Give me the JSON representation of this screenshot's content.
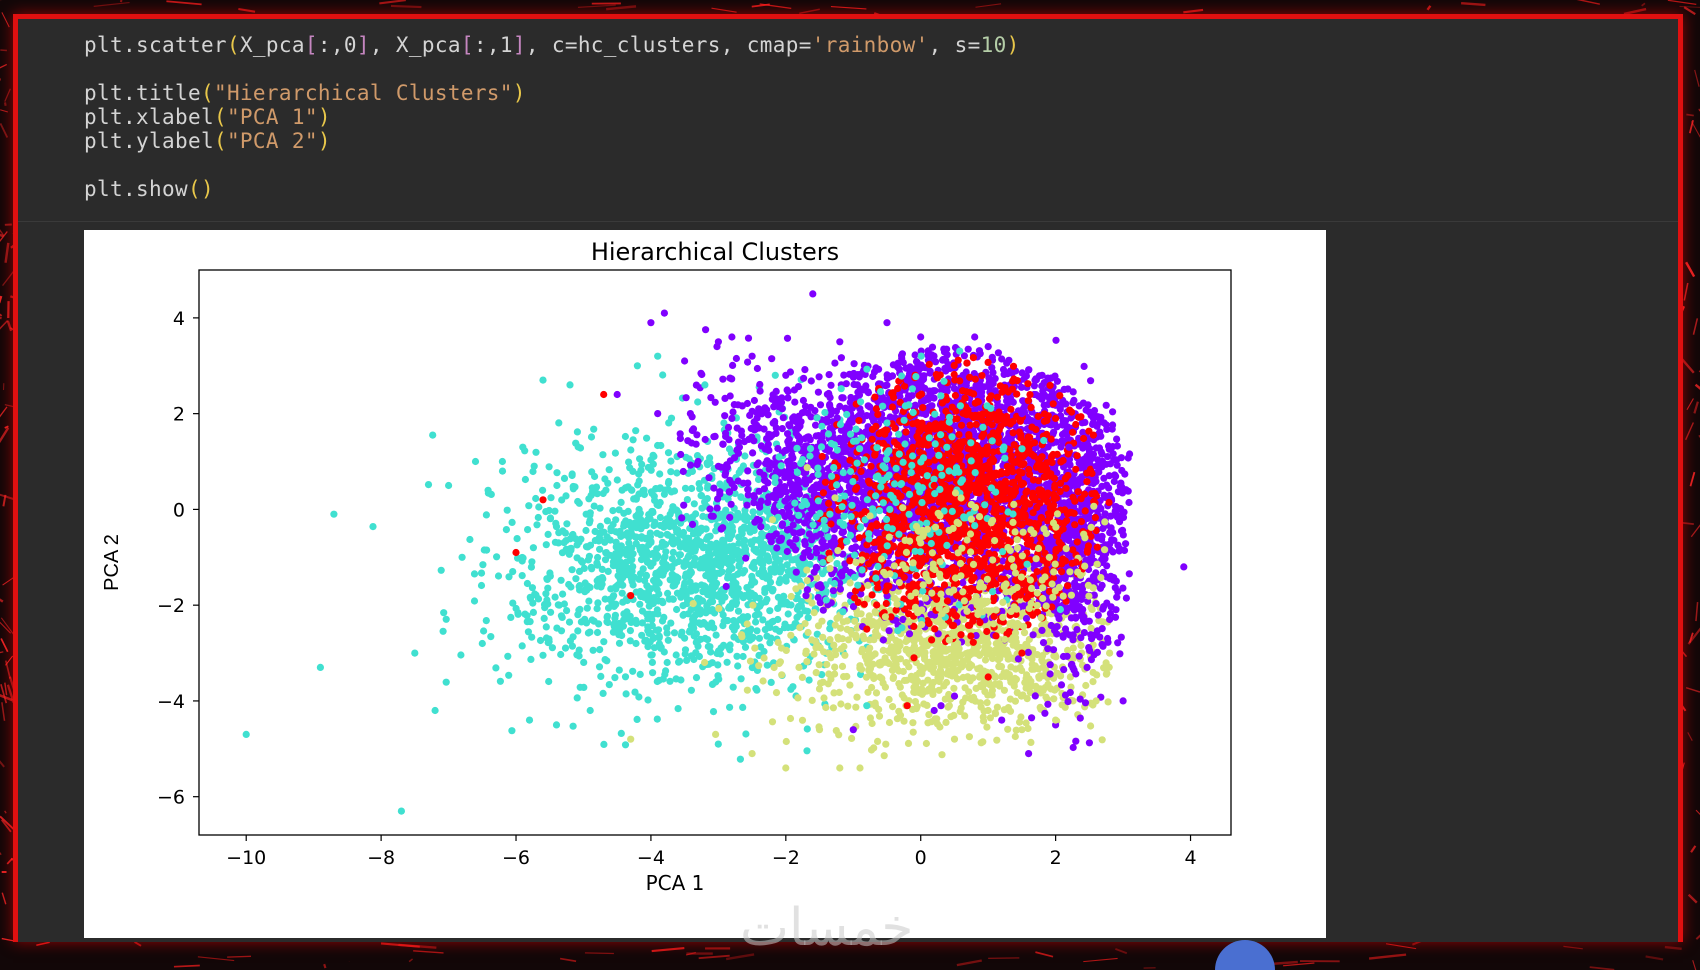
{
  "code": {
    "lines": [
      [
        {
          "t": "plt.scatter",
          "c": "tk-id"
        },
        {
          "t": "(",
          "c": "tk-br"
        },
        {
          "t": "X_pca",
          "c": "tk-id"
        },
        {
          "t": "[",
          "c": "tk-br2"
        },
        {
          "t": ":,0",
          "c": "tk-op"
        },
        {
          "t": "]",
          "c": "tk-br2"
        },
        {
          "t": ", ",
          "c": "tk-op"
        },
        {
          "t": "X_pca",
          "c": "tk-id"
        },
        {
          "t": "[",
          "c": "tk-br2"
        },
        {
          "t": ":,1",
          "c": "tk-op"
        },
        {
          "t": "]",
          "c": "tk-br2"
        },
        {
          "t": ", c=hc_clusters, cmap=",
          "c": "tk-op"
        },
        {
          "t": "'rainbow'",
          "c": "tk-str"
        },
        {
          "t": ", s=",
          "c": "tk-op"
        },
        {
          "t": "10",
          "c": "tk-num"
        },
        {
          "t": ")",
          "c": "tk-br"
        }
      ],
      [],
      [
        {
          "t": "plt.title",
          "c": "tk-id"
        },
        {
          "t": "(",
          "c": "tk-br"
        },
        {
          "t": "\"Hierarchical Clusters\"",
          "c": "tk-str"
        },
        {
          "t": ")",
          "c": "tk-br"
        }
      ],
      [
        {
          "t": "plt.xlabel",
          "c": "tk-id"
        },
        {
          "t": "(",
          "c": "tk-br"
        },
        {
          "t": "\"PCA 1\"",
          "c": "tk-str"
        },
        {
          "t": ")",
          "c": "tk-br"
        }
      ],
      [
        {
          "t": "plt.ylabel",
          "c": "tk-id"
        },
        {
          "t": "(",
          "c": "tk-br"
        },
        {
          "t": "\"PCA 2\"",
          "c": "tk-str"
        },
        {
          "t": ")",
          "c": "tk-br"
        }
      ],
      [],
      [
        {
          "t": "plt.show",
          "c": "tk-id"
        },
        {
          "t": "()",
          "c": "tk-br"
        }
      ]
    ]
  },
  "chart_data": {
    "type": "scatter",
    "title": "Hierarchical Clusters",
    "xlabel": "PCA 1",
    "ylabel": "PCA 2",
    "xlim": [
      -10.7,
      4.6
    ],
    "ylim": [
      -6.8,
      5.0
    ],
    "xticks": [
      -10,
      -8,
      -6,
      -4,
      -2,
      0,
      2,
      4
    ],
    "yticks": [
      -6,
      -4,
      -2,
      0,
      2,
      4
    ],
    "grid": false,
    "legend": "none",
    "cmap": "rainbow",
    "series": [
      {
        "color": "#8000ff",
        "x": [
          -1.6,
          -3.8,
          -4.0,
          -3.0,
          -2.8,
          -3.5,
          -2.5,
          -4.5,
          -3.9,
          -3.3,
          -2.0,
          0.8,
          3.9,
          2.0,
          1.6,
          0.2,
          3.0,
          2.8,
          2.9,
          1.5,
          -1.2,
          -0.5,
          0.0,
          1.0,
          -2.2,
          -2.8,
          -3.0,
          2.2,
          2.6,
          1.8,
          -0.2,
          0.5,
          1.2,
          -1.0,
          0.3
        ],
        "y": [
          4.5,
          4.1,
          3.9,
          3.5,
          3.6,
          3.1,
          3.2,
          2.4,
          2.0,
          1.0,
          2.8,
          3.6,
          -1.2,
          -4.5,
          -5.1,
          -4.2,
          -4.0,
          -2.3,
          -1.5,
          2.0,
          3.5,
          3.9,
          3.6,
          3.4,
          2.3,
          1.9,
          0.9,
          1.3,
          0.9,
          2.8,
          2.7,
          -3.9,
          -4.4,
          -4.6,
          -4.1
        ]
      },
      {
        "color": "#ff0000",
        "x": [
          -4.7,
          -5.6,
          -6.0,
          -4.3,
          -0.2,
          1.6,
          2.3,
          -0.5,
          0.5,
          1.0,
          1.5,
          -0.8,
          -0.1,
          0.2,
          2.0,
          1.8,
          1.2
        ],
        "y": [
          2.4,
          0.2,
          -0.9,
          -1.8,
          -4.1,
          -0.7,
          -1.1,
          -1.6,
          -2.2,
          -3.5,
          -3.0,
          -2.5,
          -3.1,
          0.5,
          1.9,
          1.1,
          0.0
        ]
      },
      {
        "color": "#40e0d0",
        "x": [
          -10.0,
          -8.7,
          -8.9,
          -7.7,
          -7.0,
          -7.2,
          -6.6,
          -6.2,
          -5.9,
          -5.6,
          -5.2,
          -5.8,
          -6.5,
          -4.2,
          -3.9,
          -7.5,
          -6.8,
          -5.4,
          -4.9,
          -3.2,
          -0.8
        ],
        "y": [
          -4.7,
          -0.1,
          -3.3,
          -6.3,
          0.5,
          -4.2,
          1.0,
          0.8,
          1.3,
          2.7,
          2.6,
          -4.4,
          -2.8,
          3.0,
          3.2,
          -3.0,
          -1.0,
          -4.5,
          -4.2,
          2.6,
          -4.1
        ]
      },
      {
        "color": "#d4e17a",
        "x": [
          -4.3,
          -2.5,
          -2.0,
          -1.2,
          -0.9,
          0.5,
          1.5,
          2.6,
          -1.5,
          -0.3,
          1.0,
          2.0,
          2.8
        ],
        "y": [
          -4.8,
          -5.1,
          -5.4,
          -5.4,
          -5.4,
          -4.8,
          -4.6,
          -4.0,
          -4.6,
          -4.3,
          -4.2,
          -4.4,
          -3.0
        ]
      }
    ]
  }
}
